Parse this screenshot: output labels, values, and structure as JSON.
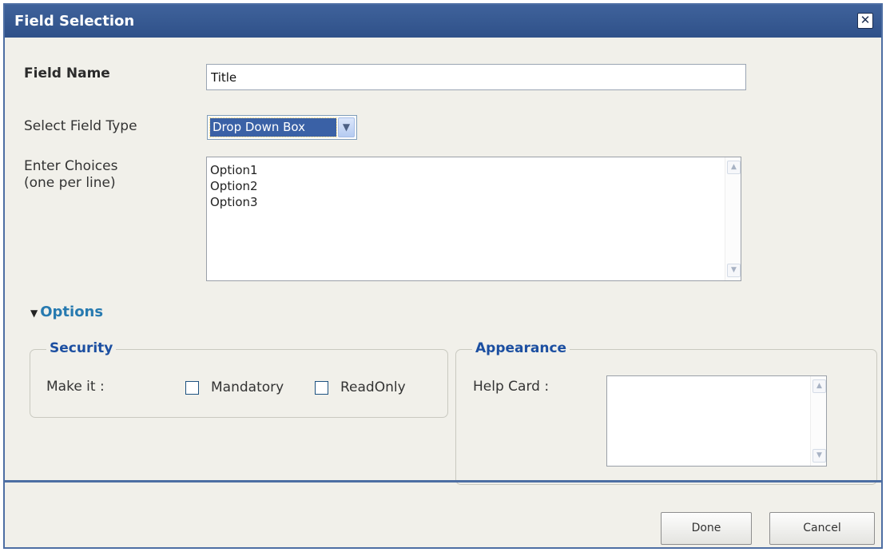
{
  "dialog": {
    "title": "Field Selection",
    "close_label": "✕"
  },
  "form": {
    "field_name_label": "Field Name",
    "field_name_value": "Title",
    "field_type_label": "Select Field Type",
    "field_type_value": "Drop Down Box",
    "choices_label_line1": "Enter Choices",
    "choices_label_line2": "(one per line)",
    "choices_value": "Option1\nOption2\nOption3"
  },
  "options": {
    "toggle_label": "Options",
    "security": {
      "legend": "Security",
      "make_it_label": "Make it :",
      "mandatory_label": "Mandatory",
      "mandatory_checked": false,
      "readonly_label": "ReadOnly",
      "readonly_checked": false
    },
    "appearance": {
      "legend": "Appearance",
      "help_card_label": "Help Card :",
      "help_card_value": ""
    }
  },
  "footer": {
    "done_label": "Done",
    "cancel_label": "Cancel"
  }
}
